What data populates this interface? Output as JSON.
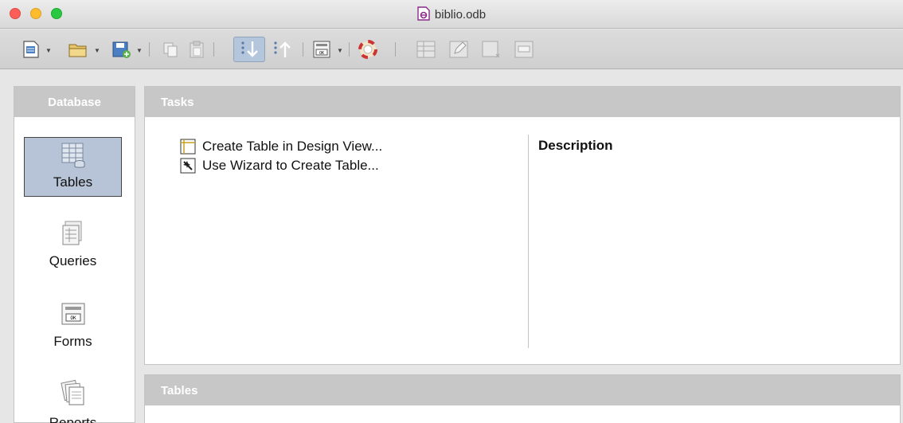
{
  "window": {
    "title": "biblio.odb"
  },
  "toolbar": {
    "icons": [
      "new-document-icon",
      "open-folder-icon",
      "save-icon",
      "copy-icon",
      "paste-icon",
      "sort-ascending-icon",
      "sort-descending-icon",
      "form-icon",
      "help-icon",
      "table-icon",
      "edit-icon",
      "delete-icon",
      "rename-icon"
    ]
  },
  "sidebar": {
    "title": "Database",
    "items": [
      {
        "label": "Tables",
        "selected": true
      },
      {
        "label": "Queries",
        "selected": false
      },
      {
        "label": "Forms",
        "selected": false
      },
      {
        "label": "Reports",
        "selected": false
      }
    ]
  },
  "tasks": {
    "title": "Tasks",
    "items": [
      {
        "label": "Create Table in Design View..."
      },
      {
        "label": "Use Wizard to Create Table..."
      }
    ],
    "description_label": "Description"
  },
  "tables": {
    "title": "Tables"
  }
}
